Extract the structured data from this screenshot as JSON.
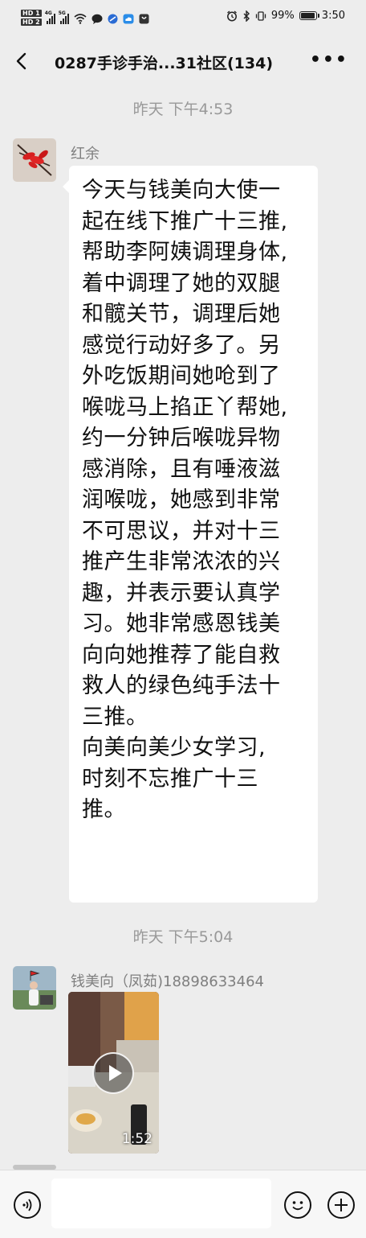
{
  "status_bar": {
    "left": {
      "hd1": "HD 1",
      "hd2": "HD 2",
      "net1": "4G",
      "net2": "5G"
    },
    "battery_text": "99%",
    "battery_level": 0.99,
    "time": "3:50"
  },
  "header": {
    "title": "0287手诊手治...31社区(134)"
  },
  "messages": [
    {
      "timestamp": "昨天 下午4:53",
      "sender": "红余",
      "text_lines": [
        "今天与钱美向大使一",
        "起在线下推广十三推,",
        "帮助李阿姨调理身体,",
        "着中调理了她的双腿",
        "和髋关节，调理后她",
        "感觉行动好多了。另",
        "外吃饭期间她呛到了",
        "喉咙马上掐正丫帮她,",
        "约一分钟后喉咙异物",
        "感消除，且有唾液滋",
        "润喉咙，她感到非常",
        "不可思议，并对十三",
        "推产生非常浓浓的兴",
        "趣，并表示要认真学",
        "习。她非常感恩钱美",
        "向向她推荐了能自救",
        "救人的绿色纯手法十",
        "三推。",
        "向美向美少女学习,",
        "时刻不忘推广十三",
        "推。"
      ]
    },
    {
      "timestamp": "昨天 下午5:04",
      "sender": "钱美向（凤茹)18898633464",
      "video_duration": "1:52"
    }
  ]
}
